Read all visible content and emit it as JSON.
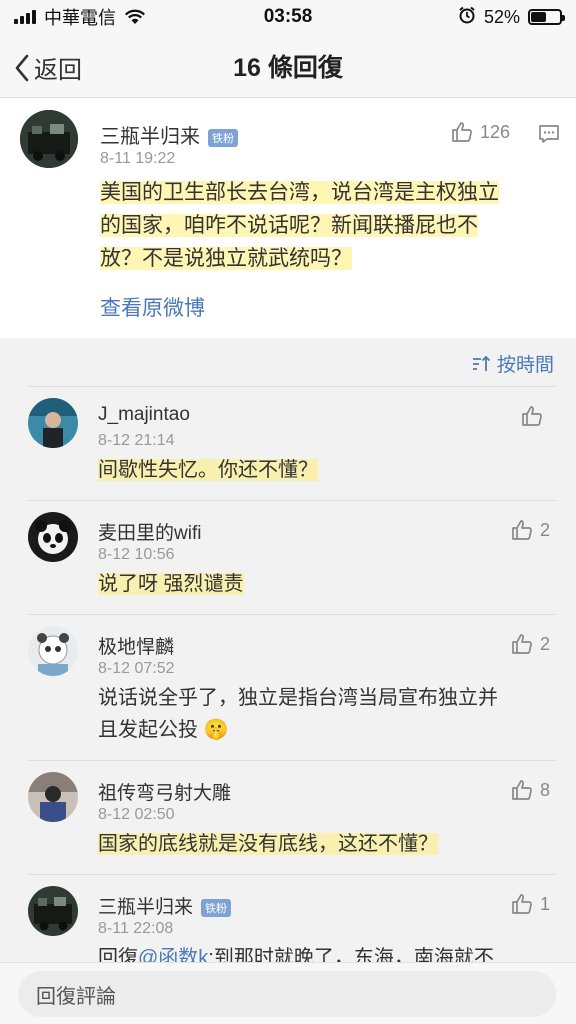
{
  "status_bar": {
    "carrier": "中華電信",
    "time": "03:58",
    "battery": "52%",
    "battery_level": 0.52
  },
  "nav": {
    "back_label": "返回",
    "title": "16 條回復"
  },
  "original_post": {
    "author": "三瓶半归来",
    "badge": "铁粉",
    "likes": "126",
    "time": "8-11 19:22",
    "text_lines": [
      "美国的卫生部长去台湾，说台湾是主权独立",
      "的国家，咱咋不说话呢？新闻联播屁也不",
      "放？不是说独立就武统吗？"
    ],
    "view_original": "查看原微博"
  },
  "sort": {
    "label": "按時間"
  },
  "comments": [
    {
      "author": "J_majintao",
      "time": "8-12 21:14",
      "text_lines": [
        "间歇性失忆。你还不懂？"
      ],
      "likes": ""
    },
    {
      "author": "麦田里的wifi",
      "time": "8-12 10:56",
      "text_lines": [
        "说了呀 强烈谴责"
      ],
      "likes": "2"
    },
    {
      "author": "极地悍麟",
      "time": "8-12 07:52",
      "text_lines": [
        "说话说全乎了，独立是指台湾当局宣布独立并",
        "且发起公投 🤫"
      ],
      "likes": "2"
    },
    {
      "author": "祖传弯弓射大雕",
      "time": "8-12 02:50",
      "text_lines": [
        "国家的底线就是没有底线，这还不懂？"
      ],
      "likes": "8"
    },
    {
      "author": "三瓶半归来",
      "badge": "铁粉",
      "time": "8-11 22:08",
      "reply_prefix": "回復",
      "mention": "@函数k",
      "text_rest": ":到那时就晚了，东海，南海就不",
      "likes": "1"
    }
  ],
  "bottom": {
    "placeholder": "回復評論"
  },
  "colors": {
    "link": "#4a7ab5",
    "highlight": "#ffee78",
    "badge": "#7da3d6"
  }
}
